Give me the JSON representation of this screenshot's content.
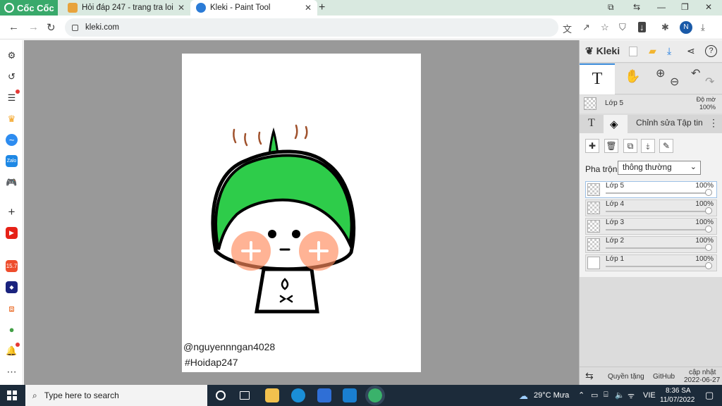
{
  "browser": {
    "brand": "Cốc Cốc",
    "tabs": [
      {
        "title": "Hỏi đáp 247 - trang tra loi",
        "favicon_color": "#e8a33c"
      },
      {
        "title": "Kleki - Paint Tool",
        "favicon_color": "#2b7bd6"
      }
    ],
    "url": "kleki.com",
    "profile_initial": "N",
    "accent": "#39a96b"
  },
  "sidebar": {
    "items": [
      {
        "name": "settings",
        "icon": "gear-icon"
      },
      {
        "name": "history",
        "icon": "history-icon"
      },
      {
        "name": "reading-list",
        "icon": "list-icon"
      },
      {
        "name": "crown",
        "icon": "crown-icon"
      },
      {
        "name": "messenger",
        "icon": "messenger-icon"
      },
      {
        "name": "zalo",
        "icon": "zalo-icon"
      },
      {
        "name": "games",
        "icon": "gamepad-icon"
      },
      {
        "name": "add",
        "icon": "plus-icon"
      },
      {
        "name": "youtube",
        "icon": "youtube-icon"
      },
      {
        "name": "shopee",
        "icon": "shopee-icon",
        "badge": "15.7"
      },
      {
        "name": "game-app",
        "icon": "game-app-icon"
      },
      {
        "name": "lazada",
        "icon": "lazada-icon"
      },
      {
        "name": "location",
        "icon": "location-icon"
      },
      {
        "name": "notifications",
        "icon": "bell-icon"
      },
      {
        "name": "more",
        "icon": "more-icon"
      }
    ]
  },
  "canvas": {
    "caption_line1": "@nguyennngan4028",
    "caption_line2": "#Hoidap247"
  },
  "kleki": {
    "title": "Kleki",
    "current_tool_glyph": "T",
    "layer_name": "Lớp 5",
    "opacity_label": "Độ mờ",
    "opacity_value": "100%",
    "tabs": {
      "edit": "Chỉnh sửa",
      "file": "Tập tin"
    },
    "blend_label": "Pha trộn",
    "blend_value": "thông thường",
    "layers": [
      {
        "name": "Lớp 5",
        "opacity": "100%",
        "active": true
      },
      {
        "name": "Lớp 4",
        "opacity": "100%",
        "active": false
      },
      {
        "name": "Lớp 3",
        "opacity": "100%",
        "active": false
      },
      {
        "name": "Lớp 2",
        "opacity": "100%",
        "active": false
      },
      {
        "name": "Lớp 1",
        "opacity": "100%",
        "active": false
      }
    ],
    "footer": {
      "privacy": "Quyền tặng",
      "github": "GitHub",
      "update_label": "cập nhật",
      "update_date": "2022-06-27"
    }
  },
  "taskbar": {
    "search_placeholder": "Type here to search",
    "weather": "29°C Mưa",
    "language": "VIE",
    "time": "8:36 SA",
    "date": "11/07/2022"
  }
}
